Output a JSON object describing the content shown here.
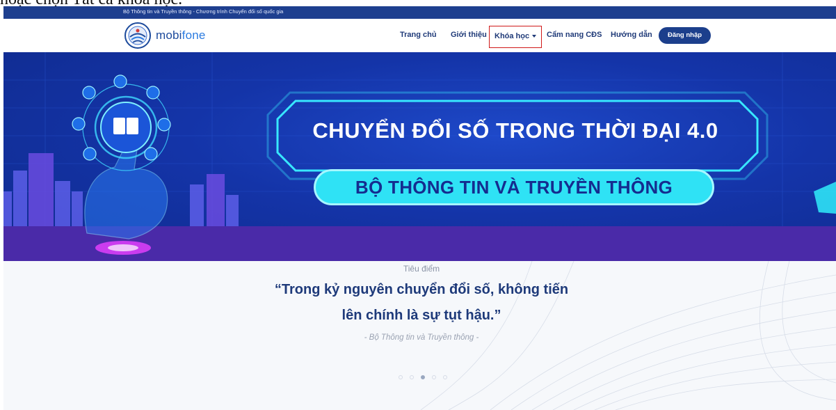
{
  "caption": {
    "text": "hoặc chọn Tất cả khóa học."
  },
  "topbar": {
    "text": "Bộ Thông tin và Truyền thông - Chương trình Chuyển đổi số quốc gia"
  },
  "logo": {
    "brand_prefix": "mobi",
    "brand_suffix": "fone",
    "emblem_icon": "national-digital-transformation-emblem"
  },
  "nav": {
    "items": [
      {
        "label": "Trang chủ"
      },
      {
        "label": "Giới thiệu"
      },
      {
        "label": "Khóa học",
        "has_dropdown": true,
        "highlighted": true
      },
      {
        "label": "Cẩm nang CĐS"
      },
      {
        "label": "Hướng dẫn"
      }
    ],
    "login_label": "Đăng nhập"
  },
  "banner": {
    "headline": "CHUYỂN ĐỔI SỐ TRONG THỜI ĐẠI 4.0",
    "subline": "BỘ THÔNG TIN VÀ TRUYỀN THÔNG",
    "icons": [
      "book-icon",
      "globe-icon",
      "clipboard-icon",
      "video-icon",
      "chart-icon",
      "search-icon",
      "settings-icon",
      "presentation-icon"
    ]
  },
  "spotlight": {
    "kicker": "Tiêu điểm",
    "quote_line_1": "“Trong kỷ nguyên chuyển đổi số, không tiến",
    "quote_line_2": "lên chính là sự tụt hậu.”",
    "author": "- Bộ Thông tin và Truyền thông -",
    "slide_count": 5,
    "active_slide": 3
  },
  "colors": {
    "topbar": "#1e3f8f",
    "nav_text": "#1f3a78",
    "login_button": "#1c3f8c",
    "highlight_box": "#d01818",
    "banner_blue": "#1434a8",
    "pill_cyan": "#2fe2f5",
    "quote_text": "#1e3a7a"
  }
}
